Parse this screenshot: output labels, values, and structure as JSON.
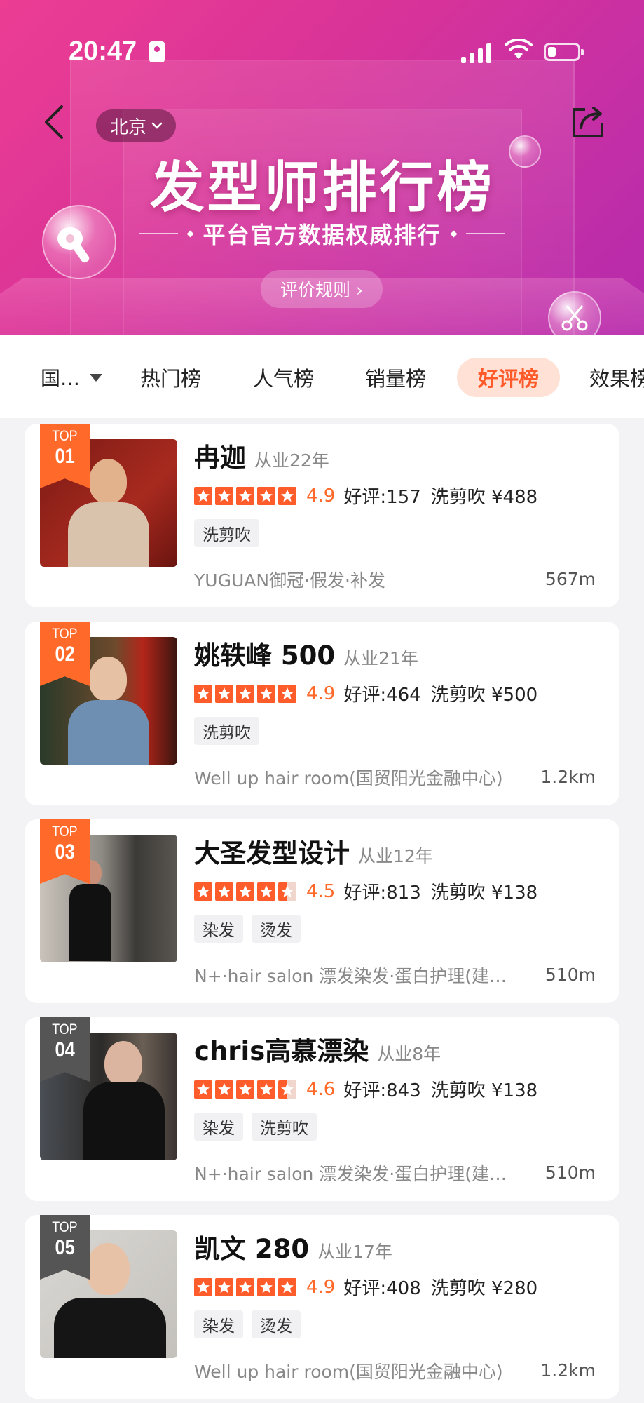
{
  "status_bar": {
    "time": "20:47"
  },
  "header": {
    "city": "北京",
    "title": "发型师排行榜",
    "subtitle": "平台官方数据权威排行",
    "rules_button": "评价规则 ›"
  },
  "tabs": {
    "city_filter": "国…",
    "items": [
      {
        "label": "热门榜",
        "active": false
      },
      {
        "label": "人气榜",
        "active": false
      },
      {
        "label": "销量榜",
        "active": false
      },
      {
        "label": "好评榜",
        "active": true
      },
      {
        "label": "效果榜",
        "active": false
      }
    ]
  },
  "stylists": [
    {
      "rank_top": "TOP",
      "rank_num": "01",
      "name": "冉迦",
      "years": "从业22年",
      "stars": 5,
      "score": "4.9",
      "reviews": "好评:157",
      "service": "洗剪吹 ¥488",
      "tags": [
        "洗剪吹"
      ],
      "salon": "YUGUAN御冠·假发·补发",
      "distance": "567m"
    },
    {
      "rank_top": "TOP",
      "rank_num": "02",
      "name": "姚轶峰 500",
      "years": "从业21年",
      "stars": 5,
      "score": "4.9",
      "reviews": "好评:464",
      "service": "洗剪吹 ¥500",
      "tags": [
        "洗剪吹"
      ],
      "salon": "Well up hair room(国贸阳光金融中心)",
      "distance": "1.2km"
    },
    {
      "rank_top": "TOP",
      "rank_num": "03",
      "name": "大圣发型设计",
      "years": "从业12年",
      "stars": 4.5,
      "score": "4.5",
      "reviews": "好评:813",
      "service": "洗剪吹 ¥138",
      "tags": [
        "染发",
        "烫发"
      ],
      "salon": "N+·hair salon 漂发染发·蛋白护理(建…",
      "distance": "510m"
    },
    {
      "rank_top": "TOP",
      "rank_num": "04",
      "name": "chris高慕漂染",
      "years": "从业8年",
      "stars": 4.5,
      "score": "4.6",
      "reviews": "好评:843",
      "service": "洗剪吹 ¥138",
      "tags": [
        "染发",
        "洗剪吹"
      ],
      "salon": "N+·hair salon 漂发染发·蛋白护理(建…",
      "distance": "510m"
    },
    {
      "rank_top": "TOP",
      "rank_num": "05",
      "name": "凯文 280",
      "years": "从业17年",
      "stars": 5,
      "score": "4.9",
      "reviews": "好评:408",
      "service": "洗剪吹 ¥280",
      "tags": [
        "染发",
        "烫发"
      ],
      "salon": "Well up hair room(国贸阳光金融中心)",
      "distance": "1.2km"
    }
  ],
  "colors": {
    "accent": "#ff5a2a",
    "badge_top3": "#ff6a2b",
    "badge_other": "#555555",
    "hero": "#d93398"
  }
}
